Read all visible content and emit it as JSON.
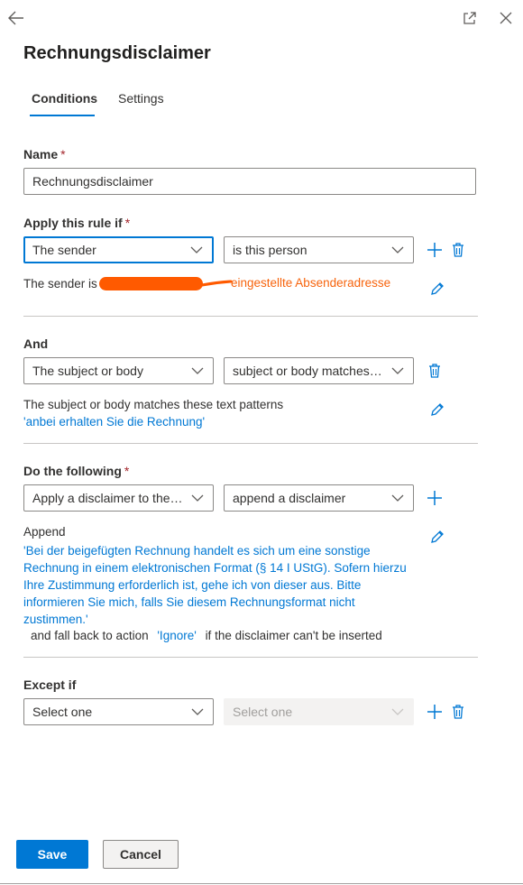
{
  "panel": {
    "title": "Rechnungsdisclaimer",
    "tabs": [
      {
        "label": "Conditions",
        "active": true
      },
      {
        "label": "Settings",
        "active": false
      }
    ]
  },
  "name_section": {
    "label": "Name",
    "required": "*",
    "value": "Rechnungsdisclaimer"
  },
  "apply_section": {
    "label": "Apply this rule if",
    "required": "*",
    "condition": "The sender",
    "operator": "is this person",
    "summary_prefix": "The sender is",
    "annotation": "eingestellte Absenderadresse"
  },
  "and_section": {
    "label": "And",
    "condition": "The subject or body",
    "operator": "subject or body matches t...",
    "summary_text": "The subject or body matches these text patterns",
    "summary_value": "'anbei erhalten Sie die Rechnung'"
  },
  "do_section": {
    "label": "Do the following",
    "required": "*",
    "action": "Apply a disclaimer to the ...",
    "operator": "append a disclaimer",
    "summary_title": "Append",
    "disclaimer_lines": [
      "'Bei der beigefügten Rechnung handelt es sich um eine sonstige",
      "Rechnung in einem elektronischen Format (§ 14 I UStG). Sofern hierzu",
      "Ihre Zustimmung erforderlich ist, gehe ich von dieser aus. Bitte",
      "informieren Sie mich, falls Sie diesem Rechnungsformat nicht",
      "zustimmen.'"
    ],
    "fallback_prefix": "and fall back to action",
    "fallback_value": "'Ignore'",
    "fallback_suffix": "if the disclaimer can't be inserted"
  },
  "except_section": {
    "label": "Except if",
    "condition_placeholder": "Select one",
    "operator_placeholder": "Select one"
  },
  "footer": {
    "save_label": "Save",
    "cancel_label": "Cancel"
  },
  "colors": {
    "accent": "#0078d4",
    "required": "#a4262c",
    "annotation": "#f7630c",
    "redaction": "#ff5a00"
  },
  "icons": [
    "back-arrow-icon",
    "popout-icon",
    "close-icon",
    "chevron-down-icon",
    "plus-icon",
    "trash-icon",
    "pencil-icon"
  ]
}
